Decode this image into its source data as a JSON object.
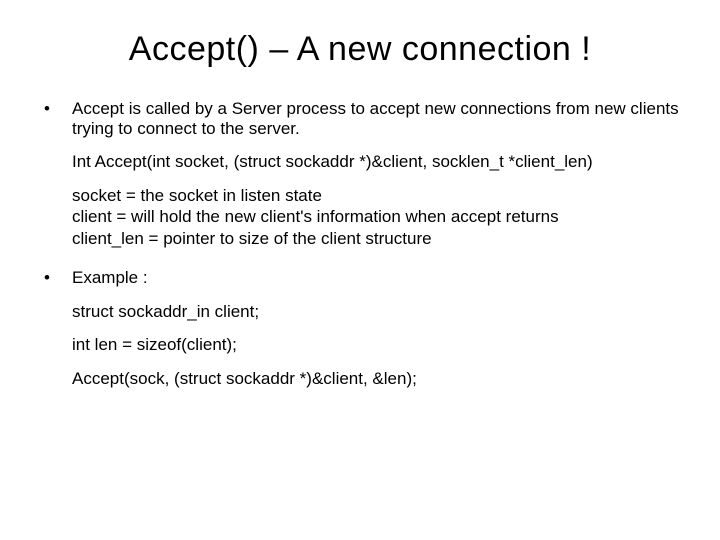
{
  "title": "Accept() – A new connection !",
  "bullet1": {
    "intro": "Accept is called by a Server process to accept new connections from new clients trying to connect to the server.",
    "signature": "Int Accept(int socket, (struct sockaddr *)&client, socklen_t *client_len)",
    "param1": "socket = the socket in listen state",
    "param2": "client = will hold the new client's information when accept returns",
    "param3": "client_len = pointer to size of the client structure"
  },
  "bullet2": {
    "label": "Example :",
    "line1": "struct sockaddr_in client;",
    "line2": "int len = sizeof(client);",
    "line3": "Accept(sock, (struct sockaddr *)&client, &len);"
  }
}
